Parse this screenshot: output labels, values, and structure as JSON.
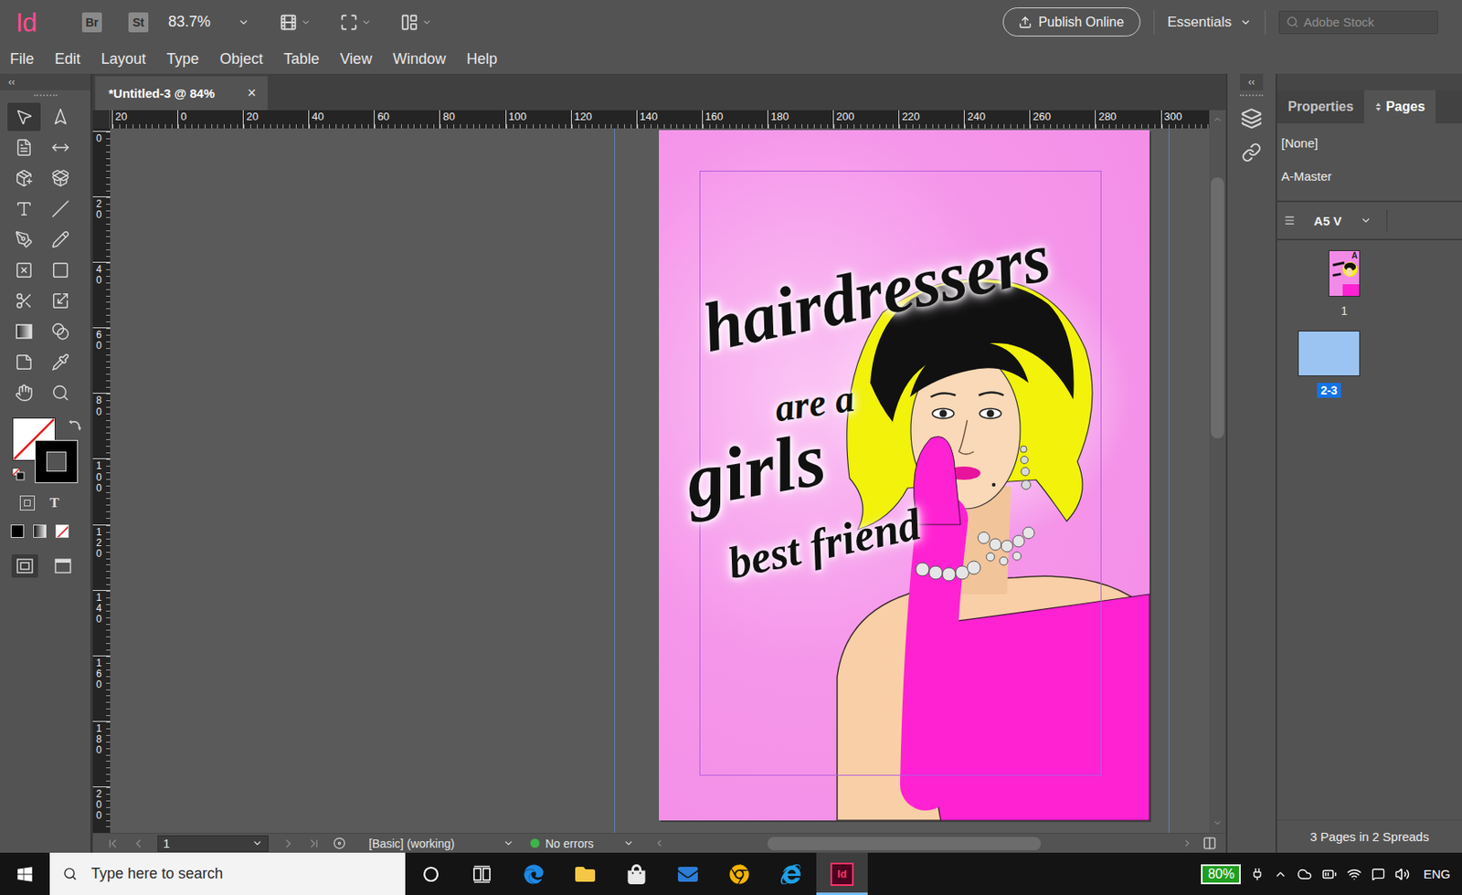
{
  "app": {
    "logo": "Id",
    "bridge": "Br",
    "stock": "St",
    "zoom": "83.7%",
    "publish": "Publish Online",
    "workspace": "Essentials",
    "search_placeholder": "Adobe Stock",
    "collapse": "‹‹"
  },
  "menu": [
    "File",
    "Edit",
    "Layout",
    "Type",
    "Object",
    "Table",
    "View",
    "Window",
    "Help"
  ],
  "tools": {
    "items": [
      {
        "kind": "selection",
        "selected": true
      },
      {
        "kind": "direct-selection",
        "selected": false
      },
      {
        "kind": "page",
        "selected": false
      },
      {
        "kind": "gap",
        "selected": false
      },
      {
        "kind": "content-collector",
        "selected": false
      },
      {
        "kind": "content-placer",
        "selected": false
      },
      {
        "kind": "type",
        "selected": false
      },
      {
        "kind": "line",
        "selected": false
      },
      {
        "kind": "pen",
        "selected": false
      },
      {
        "kind": "pencil",
        "selected": false
      },
      {
        "kind": "rectangle-frame",
        "selected": false
      },
      {
        "kind": "rectangle",
        "selected": false
      },
      {
        "kind": "scissors",
        "selected": false
      },
      {
        "kind": "free-transform",
        "selected": false
      },
      {
        "kind": "gradient-swatch",
        "selected": false
      },
      {
        "kind": "gradient-feather",
        "selected": false
      },
      {
        "kind": "note",
        "selected": false
      },
      {
        "kind": "eyedropper",
        "selected": false
      },
      {
        "kind": "hand",
        "selected": false
      },
      {
        "kind": "zoom",
        "selected": false
      }
    ],
    "fill": "none",
    "stroke": "black",
    "format_text": "T"
  },
  "document": {
    "tab": "*Untitled-3 @ 84%",
    "close": "×",
    "ruler_h": [
      "20",
      "0",
      "20",
      "40",
      "60",
      "80",
      "100",
      "120",
      "140",
      "160",
      "180",
      "200",
      "220",
      "240",
      "260",
      "280",
      "300"
    ],
    "ruler_v": [
      "0",
      "20",
      "40",
      "60",
      "80",
      "100",
      "120",
      "140",
      "160",
      "180",
      "200"
    ],
    "artwork_text": [
      "hairdressers",
      "are a",
      "girls",
      "best friend"
    ]
  },
  "panel": {
    "tabs": [
      {
        "label": "Properties",
        "selected": false
      },
      {
        "label": "Pages",
        "selected": true
      }
    ],
    "masters": [
      "[None]",
      "A-Master"
    ],
    "page_size": "A5 V",
    "pages": [
      {
        "label": "1",
        "master": "A",
        "kind": "single",
        "selected": false
      },
      {
        "label": "2-3",
        "master": "",
        "kind": "spread",
        "selected": true
      }
    ],
    "summary": "3 Pages in 2 Spreads"
  },
  "status": {
    "page": "1",
    "profile": "[Basic] (working)",
    "errors": "No errors",
    "ok": true
  },
  "taskbar": {
    "search_placeholder": "Type here to search",
    "apps": [
      {
        "kind": "cortana",
        "label": "",
        "active": false
      },
      {
        "kind": "task-view",
        "label": "",
        "active": false
      },
      {
        "kind": "edge",
        "label": "",
        "active": false
      },
      {
        "kind": "explorer",
        "label": "",
        "active": false
      },
      {
        "kind": "store",
        "label": "",
        "active": false
      },
      {
        "kind": "mail",
        "label": "",
        "active": false
      },
      {
        "kind": "chrome",
        "label": "",
        "active": false
      },
      {
        "kind": "ie",
        "label": "",
        "active": false
      },
      {
        "kind": "indesign",
        "label": "Id",
        "active": true
      }
    ],
    "battery": "80%",
    "language": "ENG"
  }
}
